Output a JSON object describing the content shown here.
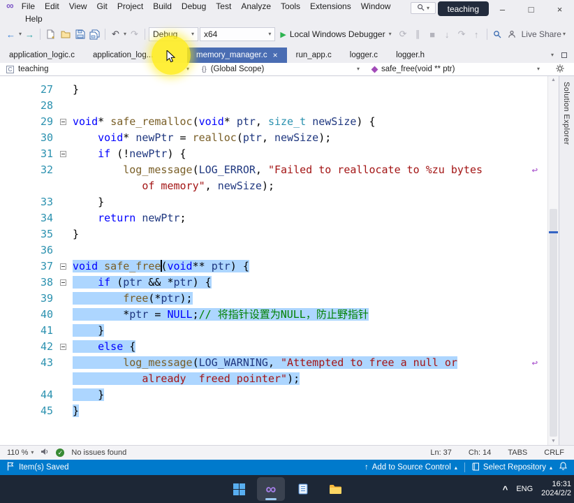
{
  "titlebar": {
    "menu_row1": [
      "File",
      "Edit",
      "View",
      "Git",
      "Project",
      "Build",
      "Debug",
      "Test",
      "Analyze",
      "Tools",
      "Extensions",
      "Window"
    ],
    "menu_row2": [
      "Help"
    ],
    "solution_badge": "teaching",
    "window_controls": {
      "minimize": "–",
      "maximize": "□",
      "close": "×"
    }
  },
  "toolbar": {
    "configuration": "Debug",
    "platform": "x64",
    "run_label": "Local Windows Debugger",
    "live_share_label": "Live Share"
  },
  "tab_bar": {
    "tabs": [
      {
        "label": "application_logic.c"
      },
      {
        "label": "application_log..."
      },
      {
        "label": "memory_manager.c",
        "close": "×",
        "active": true
      },
      {
        "label": "run_app.c"
      },
      {
        "label": "logger.c"
      },
      {
        "label": "logger.h"
      }
    ]
  },
  "navbar": {
    "project": "teaching",
    "scope": "(Global Scope)",
    "member": "safe_free(void ** ptr)"
  },
  "right_rail": {
    "tab_label": "Solution Explorer"
  },
  "editor": {
    "syntax_colors": {
      "k": "#0000ff",
      "t": "#2b91af",
      "f": "#795e26",
      "v": "#1f377f",
      "s": "#a31515",
      "c": "#008000",
      "p": "#000000"
    },
    "selection_color": "#add6ff",
    "wrap_indicator": "↩",
    "rows": [
      {
        "n": "27",
        "seg": [
          [
            "p",
            "}"
          ]
        ]
      },
      {
        "n": "28",
        "seg": []
      },
      {
        "n": "29",
        "fold": true,
        "seg": [
          [
            "k",
            "void"
          ],
          [
            "p",
            "* "
          ],
          [
            "f",
            "safe_remalloc"
          ],
          [
            "p",
            "("
          ],
          [
            "k",
            "void"
          ],
          [
            "p",
            "* "
          ],
          [
            "v",
            "ptr"
          ],
          [
            "p",
            ", "
          ],
          [
            "t",
            "size_t"
          ],
          [
            "p",
            " "
          ],
          [
            "v",
            "newSize"
          ],
          [
            "p",
            ") {"
          ]
        ]
      },
      {
        "n": "30",
        "seg": [
          [
            "p",
            "    "
          ],
          [
            "k",
            "void"
          ],
          [
            "p",
            "* "
          ],
          [
            "v",
            "newPtr"
          ],
          [
            "p",
            " = "
          ],
          [
            "f",
            "realloc"
          ],
          [
            "p",
            "("
          ],
          [
            "v",
            "ptr"
          ],
          [
            "p",
            ", "
          ],
          [
            "v",
            "newSize"
          ],
          [
            "p",
            ");"
          ]
        ]
      },
      {
        "n": "31",
        "fold": true,
        "seg": [
          [
            "p",
            "    "
          ],
          [
            "k",
            "if"
          ],
          [
            "p",
            " (!"
          ],
          [
            "v",
            "newPtr"
          ],
          [
            "p",
            ") {"
          ]
        ]
      },
      {
        "n": "32",
        "wrap_icon": true,
        "seg": [
          [
            "p",
            "        "
          ],
          [
            "f",
            "log_message"
          ],
          [
            "p",
            "("
          ],
          [
            "v",
            "LOG_ERROR"
          ],
          [
            "p",
            ", "
          ],
          [
            "s",
            "\"Failed to reallocate to %zu bytes"
          ]
        ]
      },
      {
        "n": "",
        "seg": [
          [
            "p",
            "           "
          ],
          [
            "s",
            "of memory\""
          ],
          [
            "p",
            ", "
          ],
          [
            "v",
            "newSize"
          ],
          [
            "p",
            ");"
          ]
        ]
      },
      {
        "n": "33",
        "seg": [
          [
            "p",
            "    }"
          ]
        ]
      },
      {
        "n": "34",
        "seg": [
          [
            "p",
            "    "
          ],
          [
            "k",
            "return"
          ],
          [
            "p",
            " "
          ],
          [
            "v",
            "newPtr"
          ],
          [
            "p",
            ";"
          ]
        ]
      },
      {
        "n": "35",
        "seg": [
          [
            "p",
            "}"
          ]
        ]
      },
      {
        "n": "36",
        "seg": []
      },
      {
        "n": "37",
        "fold": true,
        "sel": true,
        "seg": [
          [
            "k",
            "void"
          ],
          [
            "p",
            " "
          ],
          [
            "f",
            "safe_free"
          ],
          [
            "caret",
            ""
          ],
          [
            "p",
            "("
          ],
          [
            "k",
            "void"
          ],
          [
            "p",
            "** "
          ],
          [
            "v",
            "ptr"
          ],
          [
            "p",
            ") {"
          ]
        ]
      },
      {
        "n": "38",
        "fold": true,
        "sel": true,
        "seg": [
          [
            "p",
            "    "
          ],
          [
            "k",
            "if"
          ],
          [
            "p",
            " ("
          ],
          [
            "v",
            "ptr"
          ],
          [
            "p",
            " && *"
          ],
          [
            "v",
            "ptr"
          ],
          [
            "p",
            ") {"
          ]
        ]
      },
      {
        "n": "39",
        "sel": true,
        "seg": [
          [
            "p",
            "        "
          ],
          [
            "f",
            "free"
          ],
          [
            "p",
            "(*"
          ],
          [
            "v",
            "ptr"
          ],
          [
            "p",
            ");"
          ]
        ]
      },
      {
        "n": "40",
        "sel": true,
        "seg": [
          [
            "p",
            "        *"
          ],
          [
            "v",
            "ptr"
          ],
          [
            "p",
            " = "
          ],
          [
            "k",
            "NULL"
          ],
          [
            "p",
            ";"
          ],
          [
            "c",
            "// 将指针设置为NULL，防止野指针"
          ]
        ]
      },
      {
        "n": "41",
        "sel": true,
        "seg": [
          [
            "p",
            "    }"
          ]
        ]
      },
      {
        "n": "42",
        "fold": true,
        "sel": true,
        "seg": [
          [
            "p",
            "    "
          ],
          [
            "k",
            "else"
          ],
          [
            "p",
            " {"
          ]
        ]
      },
      {
        "n": "43",
        "wrap_icon": true,
        "sel": true,
        "seg": [
          [
            "p",
            "        "
          ],
          [
            "f",
            "log_message"
          ],
          [
            "p",
            "("
          ],
          [
            "v",
            "LOG_WARNING"
          ],
          [
            "p",
            ", "
          ],
          [
            "s",
            "\"Attempted to free a null or"
          ]
        ]
      },
      {
        "n": "",
        "sel": true,
        "seg": [
          [
            "p",
            "           "
          ],
          [
            "s",
            "already  freed pointer\""
          ],
          [
            "p",
            ");"
          ]
        ]
      },
      {
        "n": "44",
        "sel": true,
        "seg": [
          [
            "p",
            "    }"
          ]
        ]
      },
      {
        "n": "45",
        "sel": true,
        "seg": [
          [
            "p",
            "}"
          ]
        ]
      }
    ]
  },
  "editor_status": {
    "zoom": "110 %",
    "issues_message": "No issues found",
    "check_glyph": "✓",
    "line": "Ln: 37",
    "column": "Ch: 14",
    "indent_mode": "TABS",
    "line_ending": "CRLF"
  },
  "status_bar": {
    "saved_message": "Item(s) Saved",
    "add_source_control": "Add to Source Control",
    "select_repository": "Select Repository"
  },
  "taskbar": {
    "language": "ENG",
    "time": "16:31",
    "date": "2024/2/2"
  },
  "icons": {
    "back": "←",
    "forward": "→",
    "dropdown": "▾",
    "undo": "↶",
    "redo": "↷",
    "run": "▶",
    "pause": "∥",
    "stop": "■",
    "restart": "⟳",
    "step_into": "↓",
    "step_over": "↷",
    "step_out": "↑",
    "vs_logo": "∞",
    "up_arrow": "↑",
    "caret_up": "▴",
    "tray_chevron": "^",
    "c_file": "C",
    "braces": "{}",
    "scroll_up": "▲",
    "scroll_down": "▼"
  }
}
